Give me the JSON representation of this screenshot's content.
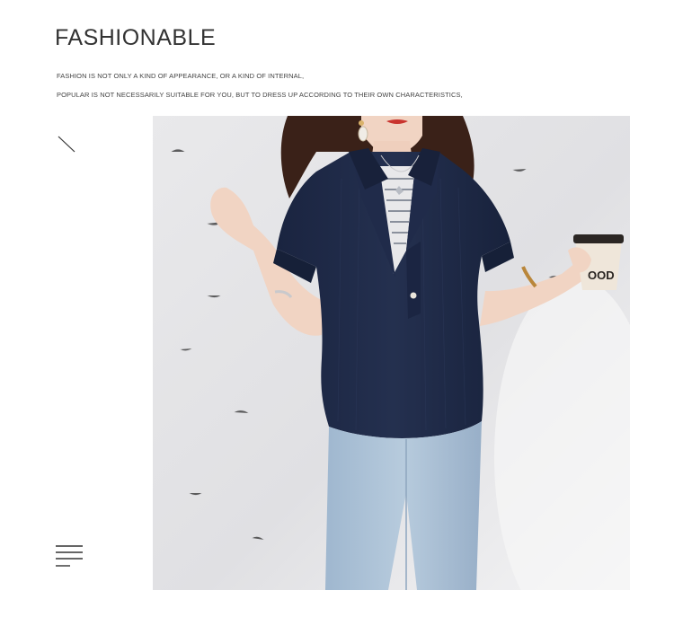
{
  "header": {
    "title": "FASHIONABLE",
    "lines": [
      "FASHION IS NOT ONLY A KIND OF APPEARANCE, OR A KIND OF INTERNAL,",
      "POPULAR IS NOT NECESSARILY SUITABLE FOR YOU, BUT TO DRESS UP ACCORDING TO THEIR OWN CHARACTERISTICS,"
    ]
  },
  "photo": {
    "cup_text": "OOD",
    "colors": {
      "wall": "#e4e4e6",
      "shirt": "#1f2a48",
      "jeans": "#a9c0d6",
      "skin": "#f1d4c3",
      "hair": "#3a2118"
    }
  },
  "icons": {
    "slash": "diagonal-slash-icon",
    "menu": "menu-lines-icon"
  }
}
